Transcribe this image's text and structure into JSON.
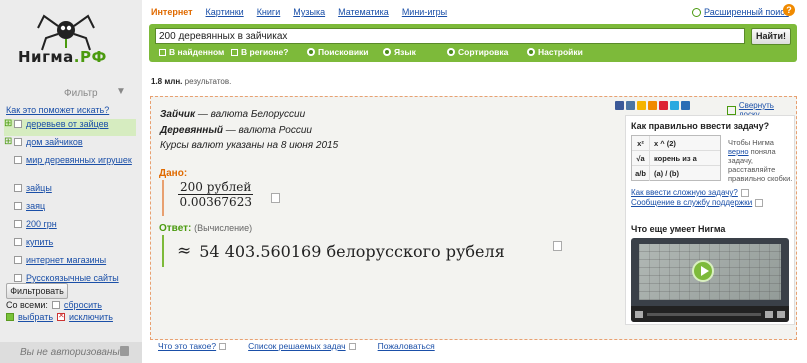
{
  "sidebar": {
    "logo_text_main": "Нигма",
    "logo_text_rf": ".РФ",
    "filter_title": "Фильтр",
    "help_link": "Как это поможет искать?",
    "items": [
      {
        "label": "деревьев от зайцев",
        "plus": "⊞",
        "selected": true
      },
      {
        "label": "дом зайчиков",
        "plus": "⊞"
      },
      {
        "label": "мир деревянных игрушек",
        "plus": ""
      },
      {
        "label": "зайцы",
        "plus": ""
      },
      {
        "label": "заяц",
        "plus": ""
      },
      {
        "label": "200 грн",
        "plus": ""
      },
      {
        "label": "купить",
        "plus": ""
      },
      {
        "label": "интернет магазины",
        "plus": ""
      },
      {
        "label": "Русскоязычные сайты",
        "plus": ""
      }
    ],
    "filter_button": "Фильтровать",
    "with_all": "Со всеми:",
    "reset": "сбросить",
    "select": "выбрать",
    "exclude": "исключить",
    "auth_status": "Вы не авторизованы"
  },
  "topnav": {
    "items": [
      "Интернет",
      "Картинки",
      "Книги",
      "Музыка",
      "Математика",
      "Мини-игры"
    ],
    "active": 0,
    "advanced": "Расширенный поиск",
    "help": "?"
  },
  "search": {
    "value": "200 деревянных в зайчиках",
    "button": "Найти!",
    "options": [
      "В найденном",
      "В регионе?",
      "Поисковики",
      "Язык",
      "Сортировка",
      "Настройки"
    ]
  },
  "results": {
    "count_bold": "1.8 млн.",
    "count_rest": " результатов."
  },
  "card": {
    "def1_term": "Зайчик",
    "def1_rest": " — валюта Белоруссии",
    "def2_term": "Деревянный",
    "def2_rest": " — валюта России",
    "rates_note": "Курсы валют указаны на 8 июня 2015",
    "given_label": "Дано:",
    "numerator": "200 рублей",
    "denominator": "0.00367623",
    "answer_label": "Ответ:",
    "answer_note": "(Вычисление)",
    "approx": "≈",
    "answer_value": "54 403.560169 белорусского рубеля",
    "collapse": "Свернуть доску"
  },
  "panel": {
    "title": "Как правильно ввести задачу?",
    "hints": [
      {
        "symbol": "x²",
        "text": "x ^ (2)"
      },
      {
        "symbol": "√a",
        "text": "корень из а"
      },
      {
        "symbol": "a/b",
        "text": "(a) / (b)"
      }
    ],
    "hint_text_pre": "Чтобы Нигма ",
    "hint_text_link": "верно",
    "hint_text_post": " поняла задачу, расставляйте правильно скобки.",
    "link1": "Как ввести сложную задачу?",
    "link2": "Сообщение в службу поддержки",
    "title2": "Что еще умеет Нигма"
  },
  "footer": {
    "links": [
      "Что это такое?",
      "Список решаемых задач",
      "Пожаловаться"
    ]
  },
  "colors": {
    "accent_green": "#7dba3a",
    "accent_orange": "#e06a00",
    "link_blue": "#1a4fa8"
  }
}
